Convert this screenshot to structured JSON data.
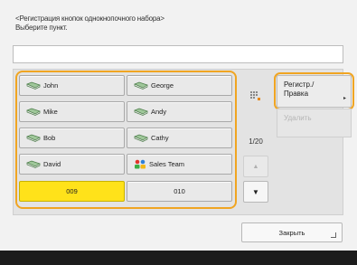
{
  "header": {
    "line1": "<Регистрация кнопок однокнопочного набора>",
    "line2": "Выберите пункт."
  },
  "keys": [
    {
      "label": "John",
      "icon": "address-book-icon"
    },
    {
      "label": "George",
      "icon": "address-book-icon"
    },
    {
      "label": "Mike",
      "icon": "address-book-icon"
    },
    {
      "label": "Andy",
      "icon": "address-book-icon"
    },
    {
      "label": "Bob",
      "icon": "address-book-icon"
    },
    {
      "label": "Cathy",
      "icon": "address-book-icon"
    },
    {
      "label": "David",
      "icon": "address-book-icon"
    },
    {
      "label": "Sales Team",
      "icon": "group-icon"
    },
    {
      "label": "009",
      "selected": true
    },
    {
      "label": "010"
    }
  ],
  "page_indicator": "1/20",
  "register_button": {
    "line1": "Регистр./",
    "line2": "Правка"
  },
  "delete_button": "Удалить",
  "close_button": "Закрыть",
  "colors": {
    "accent": "#f0a522",
    "selected": "#ffe21a"
  }
}
